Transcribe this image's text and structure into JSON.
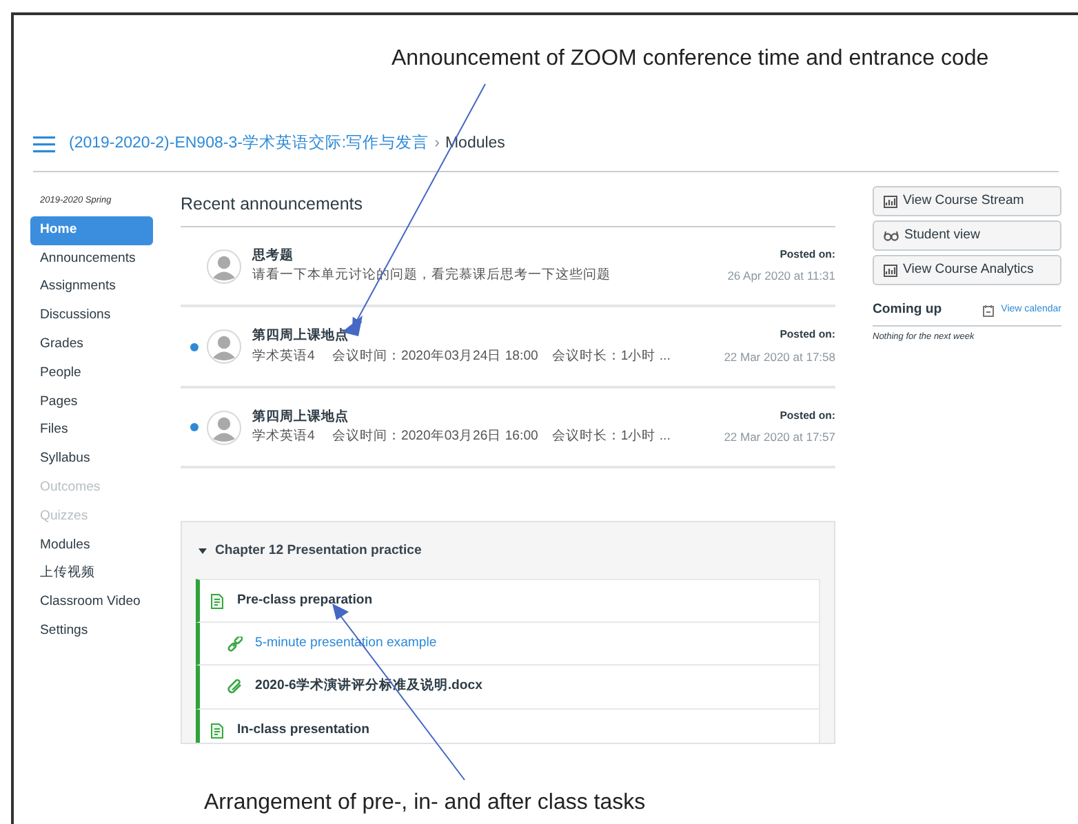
{
  "annotations": [
    {
      "text": "Announcement of ZOOM conference time and entrance code"
    },
    {
      "text": "Arrangement of pre-, in- and after class tasks"
    }
  ],
  "breadcrumb": {
    "course": "(2019-2020-2)-EN908-3-学术英语交际:写作与发言",
    "separator": "›",
    "current": "Modules"
  },
  "sidebar": {
    "term": "2019-2020 Spring",
    "items": [
      {
        "label": "Home",
        "selected": true,
        "disabled": false
      },
      {
        "label": "Announcements",
        "selected": false,
        "disabled": false
      },
      {
        "label": "Assignments",
        "selected": false,
        "disabled": false
      },
      {
        "label": "Discussions",
        "selected": false,
        "disabled": false
      },
      {
        "label": "Grades",
        "selected": false,
        "disabled": false
      },
      {
        "label": "People",
        "selected": false,
        "disabled": false
      },
      {
        "label": "Pages",
        "selected": false,
        "disabled": false
      },
      {
        "label": "Files",
        "selected": false,
        "disabled": false
      },
      {
        "label": "Syllabus",
        "selected": false,
        "disabled": false
      },
      {
        "label": "Outcomes",
        "selected": false,
        "disabled": true
      },
      {
        "label": "Quizzes",
        "selected": false,
        "disabled": true
      },
      {
        "label": "Modules",
        "selected": false,
        "disabled": false
      },
      {
        "label": "上传视频",
        "selected": false,
        "disabled": false
      },
      {
        "label": "Classroom Video",
        "selected": false,
        "disabled": false
      },
      {
        "label": "Settings",
        "selected": false,
        "disabled": false
      }
    ]
  },
  "announcements": {
    "title": "Recent announcements",
    "items": [
      {
        "title": "思考题",
        "body": "请看一下本单元讨论的问题，看完慕课后思考一下这些问题",
        "unread": false,
        "posted_label": "Posted on:",
        "posted_date": "26 Apr 2020 at 11:31"
      },
      {
        "title": "第四周上课地点",
        "body": "学术英语4　 会议时间：2020年03月24日 18:00　会议时长：1小时 ...",
        "unread": true,
        "posted_label": "Posted on:",
        "posted_date": "22 Mar 2020 at 17:58"
      },
      {
        "title": "第四周上课地点",
        "body": "学术英语4　 会议时间：2020年03月26日 16:00　会议时长：1小时 ...",
        "unread": true,
        "posted_label": "Posted on:",
        "posted_date": "22 Mar 2020 at 17:57"
      }
    ]
  },
  "module": {
    "title": "Chapter 12 Presentation practice",
    "expanded": true,
    "items": [
      {
        "kind": "page",
        "label": "Pre-class preparation"
      },
      {
        "kind": "link",
        "label": "5-minute presentation example"
      },
      {
        "kind": "file",
        "label": "2020-6学术演讲评分标准及说明.docx"
      },
      {
        "kind": "page",
        "label": "In-class presentation"
      }
    ]
  },
  "actions": [
    {
      "kind": "chart",
      "label": "View Course Stream"
    },
    {
      "kind": "glasses",
      "label": "Student view"
    },
    {
      "kind": "chart",
      "label": "View Course Analytics"
    }
  ],
  "coming_up": {
    "title": "Coming up",
    "link": "View calendar",
    "empty_text": "Nothing for the next week"
  }
}
